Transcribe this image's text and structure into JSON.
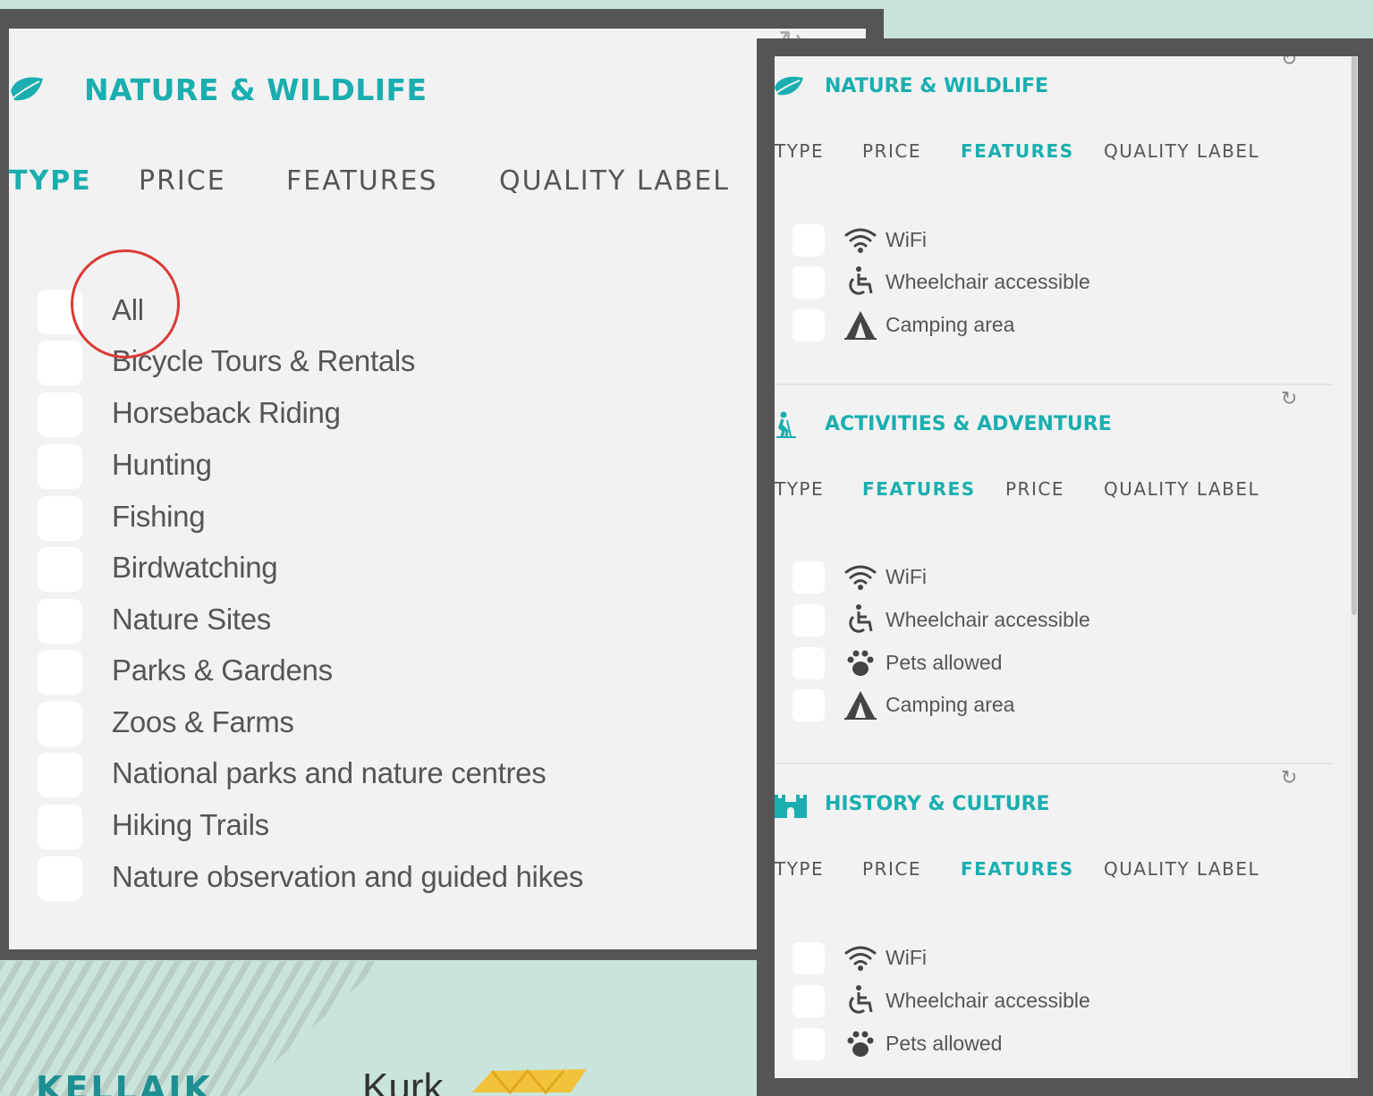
{
  "colors": {
    "accent": "#1aaeb0",
    "background": "#c9e4db",
    "frame": "#555555",
    "panel": "#f2f2f2",
    "highlight_circle": "#d93a35"
  },
  "left_panel": {
    "title": "NATURE & WILDLIFE",
    "icon": "leaf-icon",
    "tabs": [
      {
        "label": "TYPE",
        "active": true
      },
      {
        "label": "PRICE",
        "active": false
      },
      {
        "label": "FEATURES",
        "active": false
      },
      {
        "label": "QUALITY LABEL",
        "active": false
      }
    ],
    "items": [
      {
        "label": "All"
      },
      {
        "label": "Bicycle Tours & Rentals"
      },
      {
        "label": "Horseback Riding"
      },
      {
        "label": "Hunting"
      },
      {
        "label": "Fishing"
      },
      {
        "label": "Birdwatching"
      },
      {
        "label": "Nature Sites"
      },
      {
        "label": "Parks & Gardens"
      },
      {
        "label": "Zoos & Farms"
      },
      {
        "label": "National parks and nature centres"
      },
      {
        "label": "Hiking Trails"
      },
      {
        "label": "Nature observation and guided hikes"
      }
    ]
  },
  "right_panel": {
    "refresh_symbol": "↻",
    "sections": [
      {
        "title": "NATURE & WILDLIFE",
        "icon": "leaf-icon",
        "tabs": [
          {
            "label": "TYPE",
            "active": false
          },
          {
            "label": "PRICE",
            "active": false
          },
          {
            "label": "FEATURES",
            "active": true
          },
          {
            "label": "QUALITY LABEL",
            "active": false
          }
        ],
        "features": [
          {
            "label": "WiFi",
            "icon": "wifi-icon"
          },
          {
            "label": "Wheelchair accessible",
            "icon": "wheelchair-icon"
          },
          {
            "label": "Camping area",
            "icon": "tent-icon"
          }
        ]
      },
      {
        "title": "ACTIVITIES & ADVENTURE",
        "icon": "hiker-icon",
        "tabs": [
          {
            "label": "TYPE",
            "active": false
          },
          {
            "label": "FEATURES",
            "active": true
          },
          {
            "label": "PRICE",
            "active": false
          },
          {
            "label": "QUALITY LABEL",
            "active": false
          }
        ],
        "features": [
          {
            "label": "WiFi",
            "icon": "wifi-icon"
          },
          {
            "label": "Wheelchair accessible",
            "icon": "wheelchair-icon"
          },
          {
            "label": "Pets allowed",
            "icon": "paw-icon"
          },
          {
            "label": "Camping area",
            "icon": "tent-icon"
          }
        ]
      },
      {
        "title": "HISTORY & CULTURE",
        "icon": "castle-icon",
        "tabs": [
          {
            "label": "TYPE",
            "active": false
          },
          {
            "label": "PRICE",
            "active": false
          },
          {
            "label": "FEATURES",
            "active": true
          },
          {
            "label": "QUALITY LABEL",
            "active": false
          }
        ],
        "features": [
          {
            "label": "WiFi",
            "icon": "wifi-icon"
          },
          {
            "label": "Wheelchair accessible",
            "icon": "wheelchair-icon"
          },
          {
            "label": "Pets allowed",
            "icon": "paw-icon"
          }
        ]
      }
    ]
  },
  "footer": {
    "logo_left": "KELLAIK",
    "logo_right": "Kurk"
  }
}
